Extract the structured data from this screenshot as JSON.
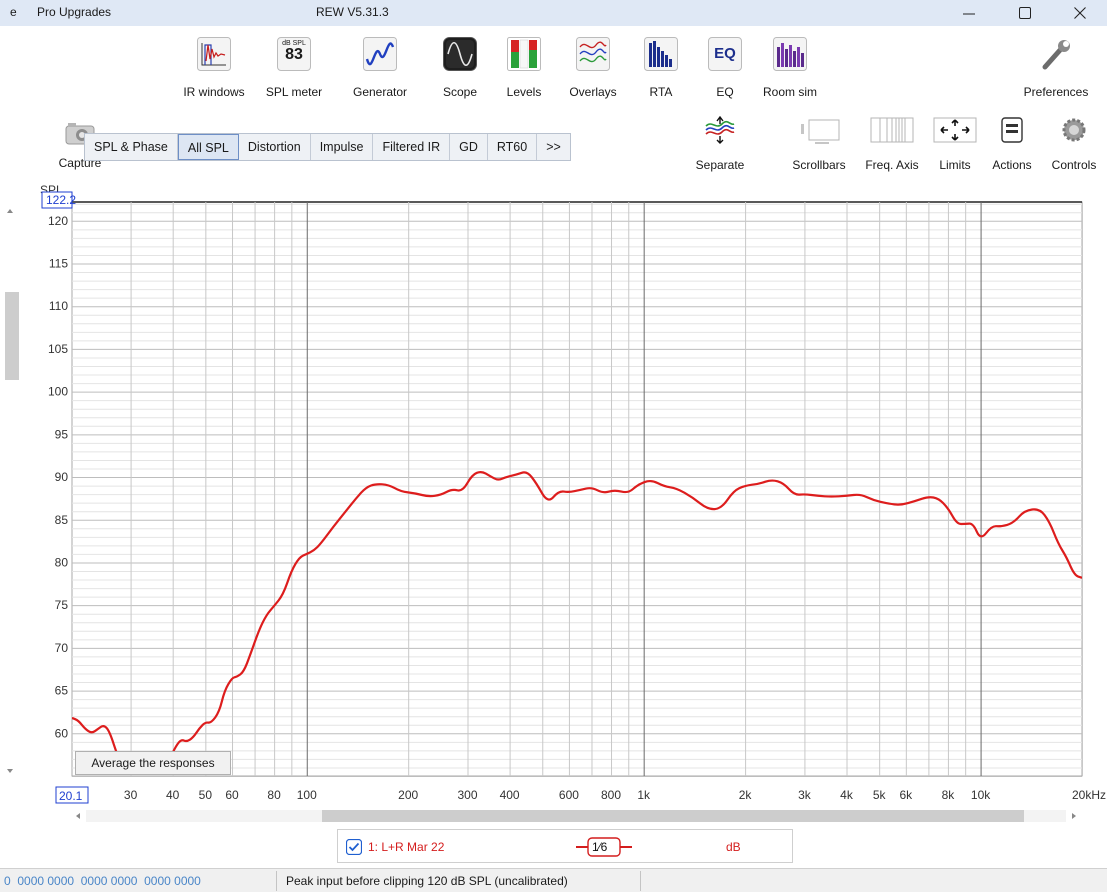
{
  "window": {
    "menu_partial": "e",
    "menu_pro": "Pro Upgrades",
    "title": "REW V5.31.3"
  },
  "toolbar": {
    "items": [
      {
        "label": "IR windows"
      },
      {
        "label": "SPL meter",
        "badge_top": "dB SPL",
        "badge_value": "83"
      },
      {
        "label": "Generator"
      },
      {
        "label": "Scope"
      },
      {
        "label": "Levels"
      },
      {
        "label": "Overlays"
      },
      {
        "label": "RTA"
      },
      {
        "label": "EQ",
        "badge_value": "EQ"
      },
      {
        "label": "Room sim"
      },
      {
        "label": "Preferences"
      }
    ],
    "capture_label": "Capture"
  },
  "tabs": [
    "SPL & Phase",
    "All SPL",
    "Distortion",
    "Impulse",
    "Filtered IR",
    "GD",
    "RT60",
    ">>"
  ],
  "active_tab": "All SPL",
  "right_tools": [
    "Separate",
    "Scrollbars",
    "Freq. Axis",
    "Limits",
    "Actions",
    "Controls"
  ],
  "graph": {
    "y_label": "SPL",
    "y_top_value": "122.2",
    "x_left_value": "20.1",
    "average_button": "Average the responses"
  },
  "chart_data": {
    "type": "line",
    "xlabel": "kHz",
    "ylabel": "SPL",
    "x_scale": "log",
    "xlim": [
      20.1,
      20000
    ],
    "ylim": [
      55,
      122.2
    ],
    "grid": true,
    "x_ticks": [
      "30",
      "40",
      "50",
      "60",
      "80",
      "100",
      "200",
      "300",
      "400",
      "600",
      "800",
      "1k",
      "2k",
      "3k",
      "4k",
      "5k",
      "6k",
      "8k",
      "10k",
      "20kHz"
    ],
    "y_ticks": [
      "120",
      "115",
      "110",
      "105",
      "100",
      "95",
      "90",
      "85",
      "80",
      "75",
      "70",
      "65",
      "60"
    ],
    "series": [
      {
        "name": "1: L+R Mar 22",
        "color": "#dd1d1d",
        "x": [
          20.1,
          21,
          22,
          23,
          24,
          25,
          26,
          27.5,
          29,
          31,
          33,
          35,
          37,
          39,
          41,
          42.5,
          44,
          46,
          48,
          50,
          52,
          55,
          57,
          60,
          62,
          65,
          68,
          72,
          76,
          80,
          85,
          90,
          95,
          100,
          105,
          110,
          120,
          130,
          140,
          150,
          160,
          175,
          190,
          210,
          230,
          250,
          270,
          290,
          310,
          330,
          350,
          370,
          390,
          420,
          450,
          480,
          520,
          560,
          600,
          650,
          700,
          760,
          820,
          900,
          960,
          1050,
          1150,
          1250,
          1400,
          1550,
          1700,
          1850,
          2000,
          2200,
          2400,
          2600,
          2800,
          3000,
          3300,
          3600,
          4000,
          4400,
          4800,
          5300,
          5800,
          6400,
          7000,
          7500,
          8000,
          8500,
          9000,
          9500,
          10000,
          10800,
          11500,
          12500,
          13500,
          15000,
          16000,
          17000,
          18000,
          19000,
          20000
        ],
        "y": [
          61.8,
          61.5,
          60.5,
          60,
          60.5,
          61,
          60.2,
          57.2,
          55.8,
          56.5,
          57.5,
          57.2,
          56.3,
          56.8,
          58.6,
          59.3,
          59,
          59.5,
          60.6,
          61.3,
          61.2,
          62.5,
          65,
          66.5,
          66.6,
          67.2,
          69.2,
          72,
          73.9,
          74.9,
          76.2,
          79,
          80.6,
          81,
          81.4,
          82.2,
          84.2,
          85.9,
          87.5,
          88.8,
          89.2,
          89.1,
          88.3,
          88.1,
          87.7,
          87.9,
          88.6,
          88.3,
          90.3,
          90.7,
          90.1,
          89.6,
          90,
          90.3,
          90.7,
          89.3,
          86.9,
          88.4,
          88.2,
          88.5,
          88.8,
          88.1,
          88.5,
          88.1,
          89.1,
          89.7,
          88.9,
          88.7,
          87.6,
          86.2,
          86.3,
          88.4,
          89,
          89.2,
          89.7,
          89.3,
          87.9,
          88,
          87.8,
          87.7,
          87.8,
          88,
          87.3,
          86.9,
          86.7,
          87.2,
          87.7,
          87.5,
          86.4,
          84.5,
          84.5,
          84.6,
          82.6,
          84.3,
          84.2,
          84.6,
          86.1,
          86.3,
          84.8,
          82.2,
          80.6,
          78.5,
          78.2
        ]
      }
    ]
  },
  "legend": {
    "checkbox_checked": true,
    "series_label": "1: L+R Mar 22",
    "smoothing": "1⁄6",
    "unit": "dB"
  },
  "status": {
    "bits": "0  0000 0000  0000 0000  0000 0000",
    "message": "Peak input before clipping 120 dB SPL (uncalibrated)"
  }
}
